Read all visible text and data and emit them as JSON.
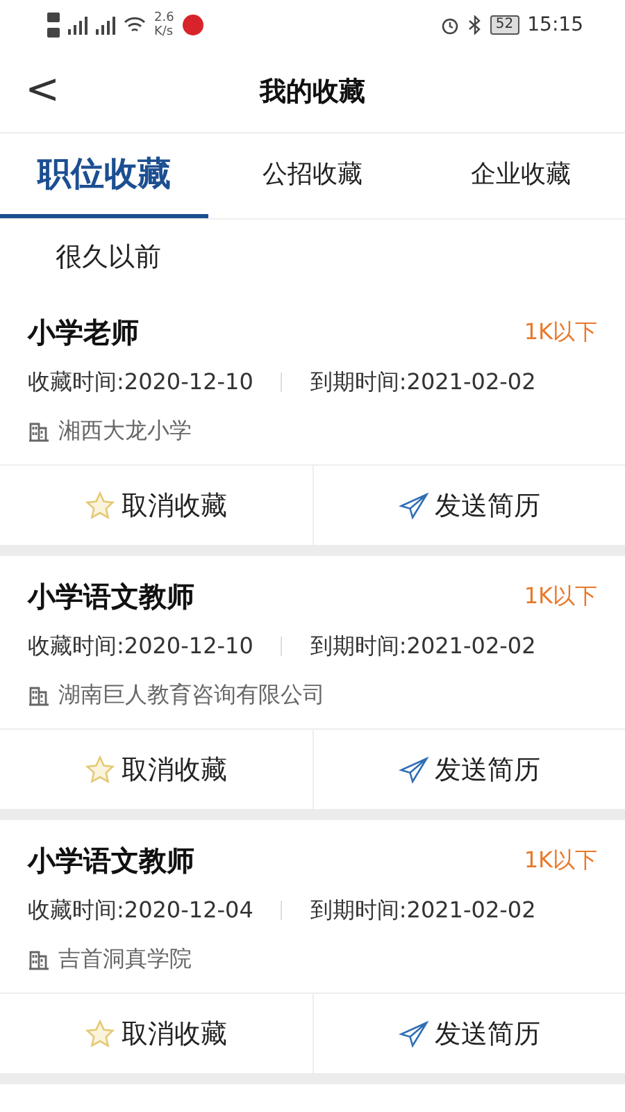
{
  "status_bar": {
    "speed_value": "2.6",
    "speed_unit": "K/s",
    "battery": "52",
    "time": "15:15"
  },
  "header": {
    "back": "<",
    "title": "我的收藏"
  },
  "tabs": [
    {
      "label": "职位收藏",
      "selected": true
    },
    {
      "label": "公招收藏",
      "selected": false
    },
    {
      "label": "企业收藏",
      "selected": false
    }
  ],
  "section_label": "很久以前",
  "cards": [
    {
      "title": "小学老师",
      "salary": "1K以下",
      "saved": "收藏时间:2020-12-10",
      "expires": "到期时间:2021-02-02",
      "company": "湘西大龙小学",
      "actions": [
        "取消收藏",
        "发送简历"
      ]
    },
    {
      "title": "小学语文教师",
      "salary": "1K以下",
      "saved": "收藏时间:2020-12-10",
      "expires": "到期时间:2021-02-02",
      "company": "湖南巨人教育咨询有限公司",
      "actions": [
        "取消收藏",
        "发送简历"
      ]
    },
    {
      "title": "小学语文教师",
      "salary": "1K以下",
      "saved": "收藏时间:2020-12-04",
      "expires": "到期时间:2021-02-02",
      "company": "吉首洞真学院",
      "actions": [
        "取消收藏",
        "发送简历"
      ]
    }
  ]
}
